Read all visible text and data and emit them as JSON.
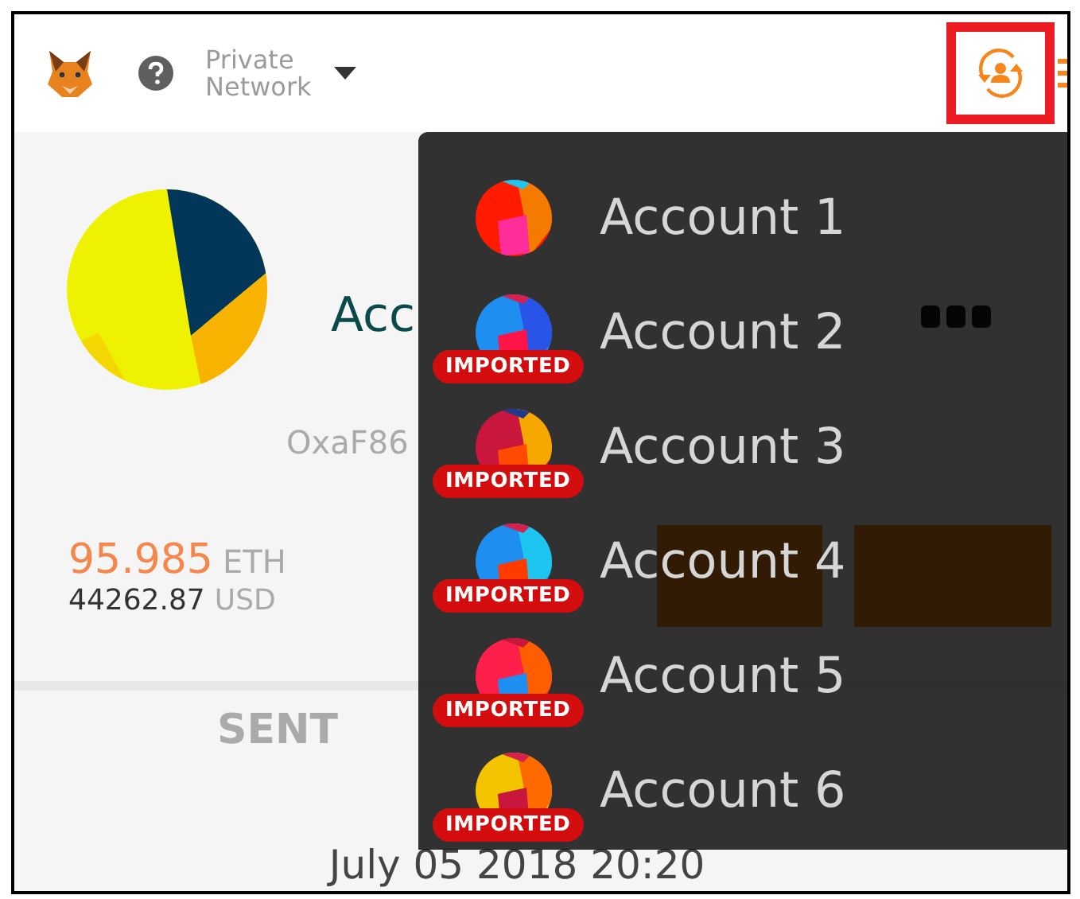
{
  "header": {
    "network": {
      "line_1": "Private",
      "line_2": "Network"
    },
    "account_switch": {
      "highlighted": true
    }
  },
  "account": {
    "name": "Acc",
    "address": "OxaF86",
    "balance": {
      "amount": "95.985",
      "unit": "ETH"
    },
    "fiat": {
      "amount": "44262.87",
      "unit": "USD"
    }
  },
  "tabs": [
    {
      "label": "SENT",
      "selected": false
    }
  ],
  "transactions": [
    {
      "date": "July 05 2018 20:20"
    }
  ],
  "account_menu": {
    "accounts": [
      {
        "name": "Account 1"
      },
      {
        "name": "Account 2",
        "badge": "IMPORTED"
      },
      {
        "name": "Account 3",
        "badge": "IMPORTED"
      },
      {
        "name": "Account 4",
        "badge": "IMPORTED"
      },
      {
        "name": "Account 5",
        "badge": "IMPORTED"
      },
      {
        "name": "Account 6",
        "badge": "IMPORTED"
      }
    ]
  }
}
